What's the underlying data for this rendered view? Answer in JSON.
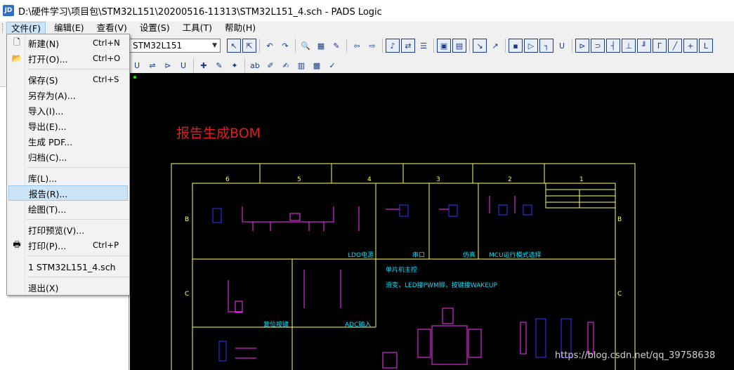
{
  "window": {
    "title": "D:\\硬件学习\\项目包\\STM32L151\\20200516-11313\\STM32L151_4.sch - PADS Logic",
    "icon": "pads-logic-icon"
  },
  "menubar": [
    {
      "label": "文件(F)"
    },
    {
      "label": "编辑(E)"
    },
    {
      "label": "查看(V)"
    },
    {
      "label": "设置(S)"
    },
    {
      "label": "工具(T)"
    },
    {
      "label": "帮助(H)"
    }
  ],
  "toolbar": {
    "combo_value": "STM32L151"
  },
  "file_menu": {
    "items": [
      {
        "label": "新建(N)",
        "shortcut": "Ctrl+N",
        "icon": "new-file-icon"
      },
      {
        "label": "打开(O)...",
        "shortcut": "Ctrl+O",
        "icon": "open-folder-icon"
      },
      {
        "label": "保存(S)",
        "shortcut": "Ctrl+S",
        "icon": "save-icon"
      },
      {
        "label": "另存为(A)...",
        "shortcut": ""
      },
      {
        "label": "导入(I)...",
        "shortcut": ""
      },
      {
        "label": "导出(E)...",
        "shortcut": ""
      },
      {
        "label": "生成 PDF...",
        "shortcut": ""
      },
      {
        "label": "归档(C)...",
        "shortcut": ""
      },
      {
        "label": "库(L)...",
        "shortcut": ""
      },
      {
        "label": "报告(R)...",
        "shortcut": ""
      },
      {
        "label": "绘图(T)...",
        "shortcut": ""
      },
      {
        "label": "打印预览(V)...",
        "shortcut": ""
      },
      {
        "label": "打印(P)...",
        "shortcut": "Ctrl+P",
        "icon": "printer-icon"
      },
      {
        "label": "1 STM32L151_4.sch",
        "shortcut": ""
      },
      {
        "label": "退出(X)",
        "shortcut": ""
      }
    ]
  },
  "schematic": {
    "annotation": "报告生成BOM",
    "labels": {
      "ldo": "LDO电源",
      "serial": "串口",
      "sim": "仿真",
      "mcu_mode": "MCU运行模式选择",
      "reset": "复位按键",
      "adc": "ADC输入",
      "mcu_main": "单片机主控",
      "pwm_note": "滑变，LED接PWM脚，按键接WAKEUP"
    },
    "col_numbers": [
      "6",
      "5",
      "4",
      "3",
      "2",
      "1"
    ],
    "row_letters": [
      "B",
      "C"
    ]
  },
  "watermark": "https://blog.csdn.net/qq_39758638",
  "colors": {
    "border": "#ffff66",
    "component": "#ff33ff",
    "wire": "#3333ff",
    "label": "#00e0ff",
    "annotation": "#e81a1a"
  }
}
